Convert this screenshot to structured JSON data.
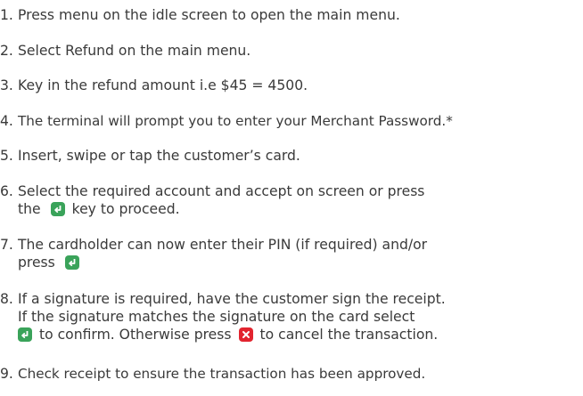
{
  "steps": [
    {
      "number": "1.",
      "text": "Press menu on the idle screen to open the main menu."
    },
    {
      "number": "2.",
      "text": "Select Refund on the main menu."
    },
    {
      "number": "3.",
      "text": "Key in the refund amount i.e $45 = 4500."
    },
    {
      "number": "4.",
      "text": "The terminal will prompt you to enter your Merchant Password.*"
    },
    {
      "number": "5.",
      "text": "Insert, swipe or tap the customer’s card."
    },
    {
      "number": "6.",
      "line1": "Select the required account and accept on screen or press",
      "line2_before": "the",
      "line2_after": "key to proceed."
    },
    {
      "number": "7.",
      "line1": "The cardholder can now enter their PIN (if required) and/or",
      "line2_before": "press"
    },
    {
      "number": "8.",
      "line1": "If a signature is required, have the customer sign the receipt.",
      "line2": "If the signature matches the signature on the card select",
      "line3_middle": "to confirm. Otherwise press",
      "line3_after": "to cancel the transaction."
    },
    {
      "number": "9.",
      "text": "Check receipt to ensure the transaction has been approved."
    }
  ],
  "icons": {
    "enter_key": "enter-key-icon",
    "cancel_key": "cancel-key-icon"
  },
  "colors": {
    "text": "#3a3a3a",
    "enter_key": "#3aa35a",
    "cancel_key": "#e2242f"
  }
}
